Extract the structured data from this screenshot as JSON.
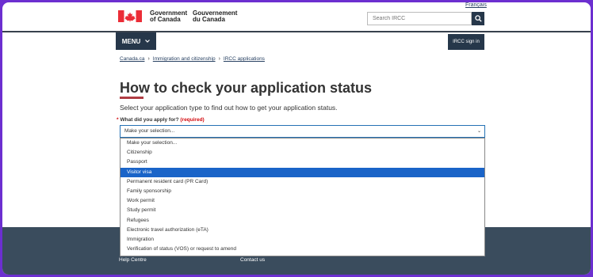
{
  "header": {
    "lang_link": "Français",
    "gov_en_line1": "Government",
    "gov_en_line2": "of Canada",
    "gov_fr_line1": "Gouvernement",
    "gov_fr_line2": "du Canada",
    "search_placeholder": "Search IRCC",
    "search_icon": "search-icon",
    "menu_label": "MENU",
    "signin_label": "IRCC sign in"
  },
  "breadcrumb": [
    "Canada.ca",
    "Immigration and citizenship",
    "IRCC applications"
  ],
  "main": {
    "title": "How to check your application status",
    "lead": "Select your application type to find out how to get your application status.",
    "question_label": "What did you apply for?",
    "required_text": "(required)",
    "selected_value": "Make your selection..."
  },
  "dropdown": {
    "options": [
      "Make your selection...",
      "Citizenship",
      "Passport",
      "Visitor visa",
      "Permanent resident card (PR Card)",
      "Family sponsorship",
      "Work permit",
      "Study permit",
      "Refugees",
      "Electronic travel authorization (eTA)",
      "Immigration",
      "Verification of status (VOS) or request to amend"
    ],
    "highlighted_index": 3
  },
  "footer": {
    "links": [
      "Help Centre",
      "Contact us"
    ]
  },
  "colors": {
    "frame": "#6c2fd0",
    "navy": "#26374a",
    "accent_red": "#af3c43",
    "highlight": "#1a64c8",
    "footer_bg": "#3a4c5d"
  }
}
